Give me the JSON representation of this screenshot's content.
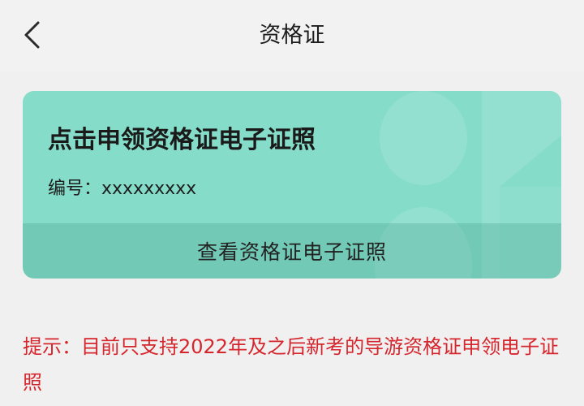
{
  "colors": {
    "page_background": "#f0f0f0",
    "card_background": "#84dcc9",
    "tip_text": "#d6262d"
  },
  "header": {
    "back_icon": "chevron-left-icon",
    "title": "资格证"
  },
  "card": {
    "title": "点击申领资格证电子证照",
    "number_text": "编号：xxxxxxxxx",
    "view_button_label": "查看资格证电子证照"
  },
  "tip": {
    "text": "提示：目前只支持2022年及之后新考的导游资格证申领电子证照"
  }
}
